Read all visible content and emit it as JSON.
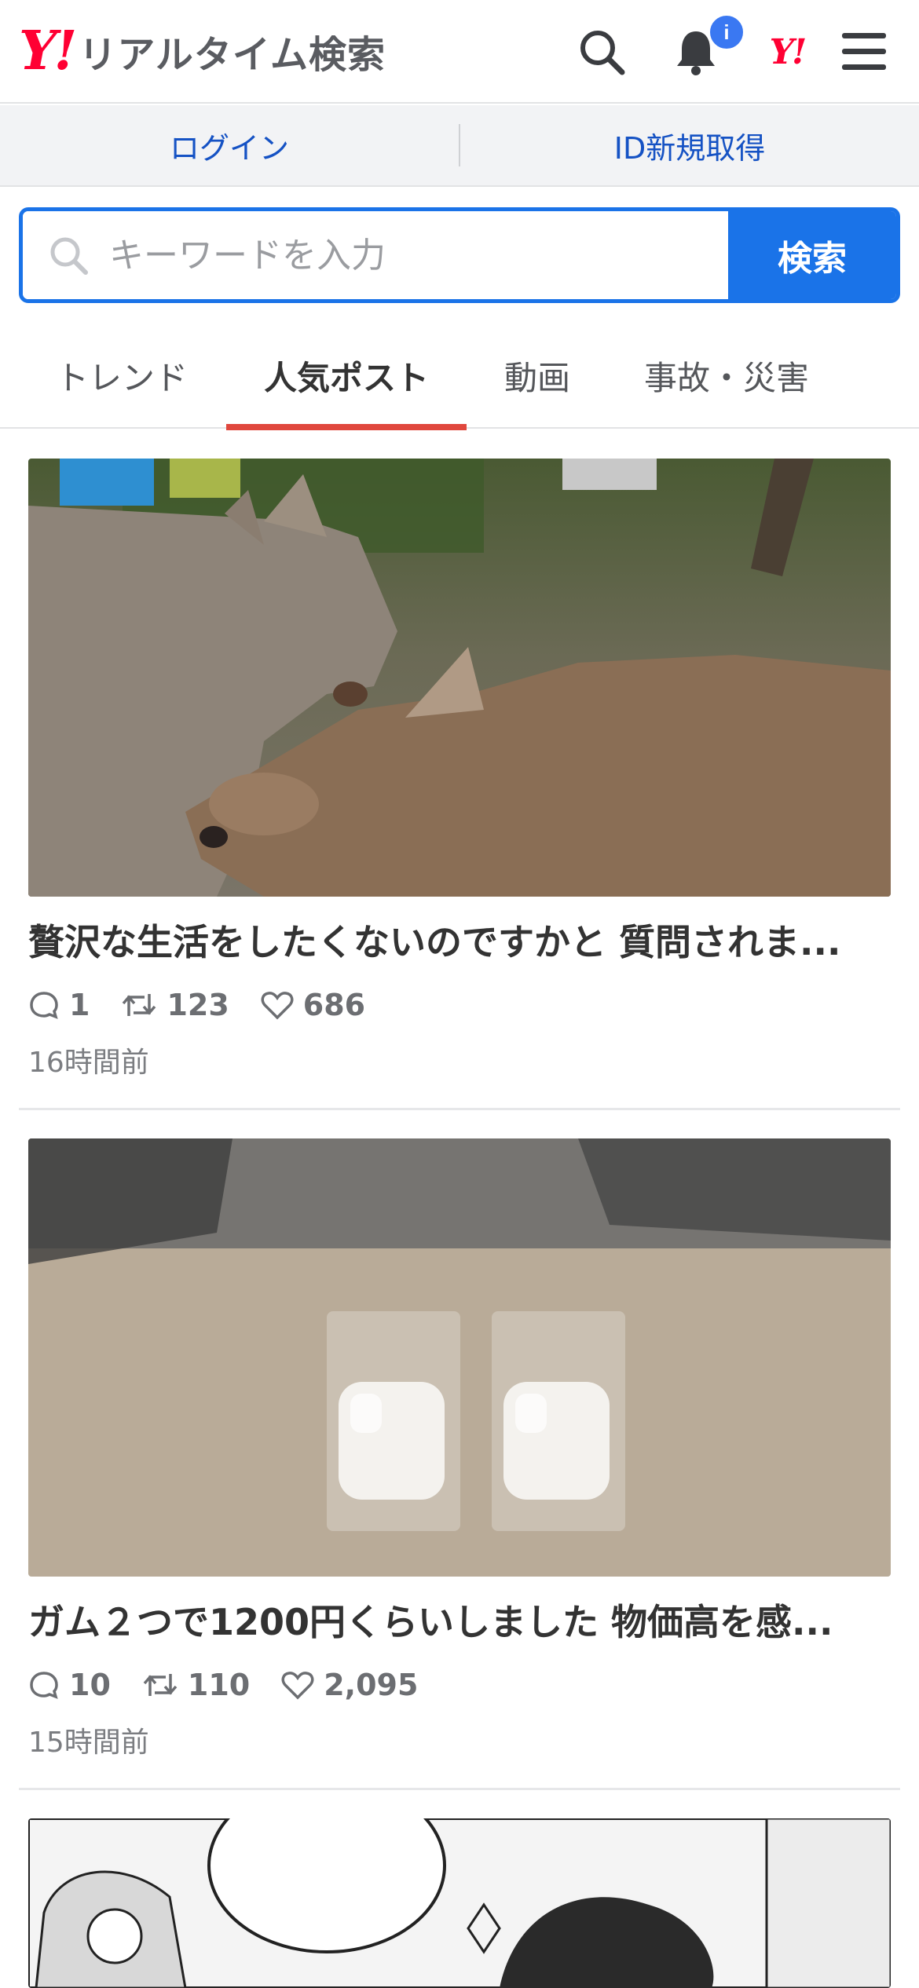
{
  "header": {
    "brand_logo": "Y!",
    "brand_title": "リアルタイム検索",
    "notification_badge": "i",
    "yahoo_logo": "Y!",
    "icons": [
      "search-icon",
      "bell-icon",
      "yahoo-logo",
      "menu-icon"
    ]
  },
  "loginbar": {
    "login": "ログイン",
    "signup": "ID新規取得"
  },
  "search": {
    "placeholder": "キーワードを入力",
    "button": "検索"
  },
  "tabs": [
    {
      "label": "トレンド",
      "active": false
    },
    {
      "label": "人気ポスト",
      "active": true
    },
    {
      "label": "動画",
      "active": false
    },
    {
      "label": "事故・災害",
      "active": false
    }
  ],
  "posts": [
    {
      "title": "贅沢な生活をしたくないのですかと 質問されま...",
      "replies": "1",
      "reposts": "123",
      "likes": "686",
      "time": "16時間前",
      "image": "two-deer-photo"
    },
    {
      "title": "ガム２つで1200円くらいしました 物価高を感...",
      "replies": "10",
      "reposts": "110",
      "likes": "2,095",
      "time": "15時間前",
      "image": "gum-packets-photo"
    },
    {
      "image": "manga-panel-image"
    }
  ],
  "colors": {
    "brand_red": "#ff0033",
    "accent_blue": "#1a73e8",
    "link_blue": "#1552c4",
    "active_tab_underline": "#e0473d",
    "badge_blue": "#3a78f2"
  }
}
